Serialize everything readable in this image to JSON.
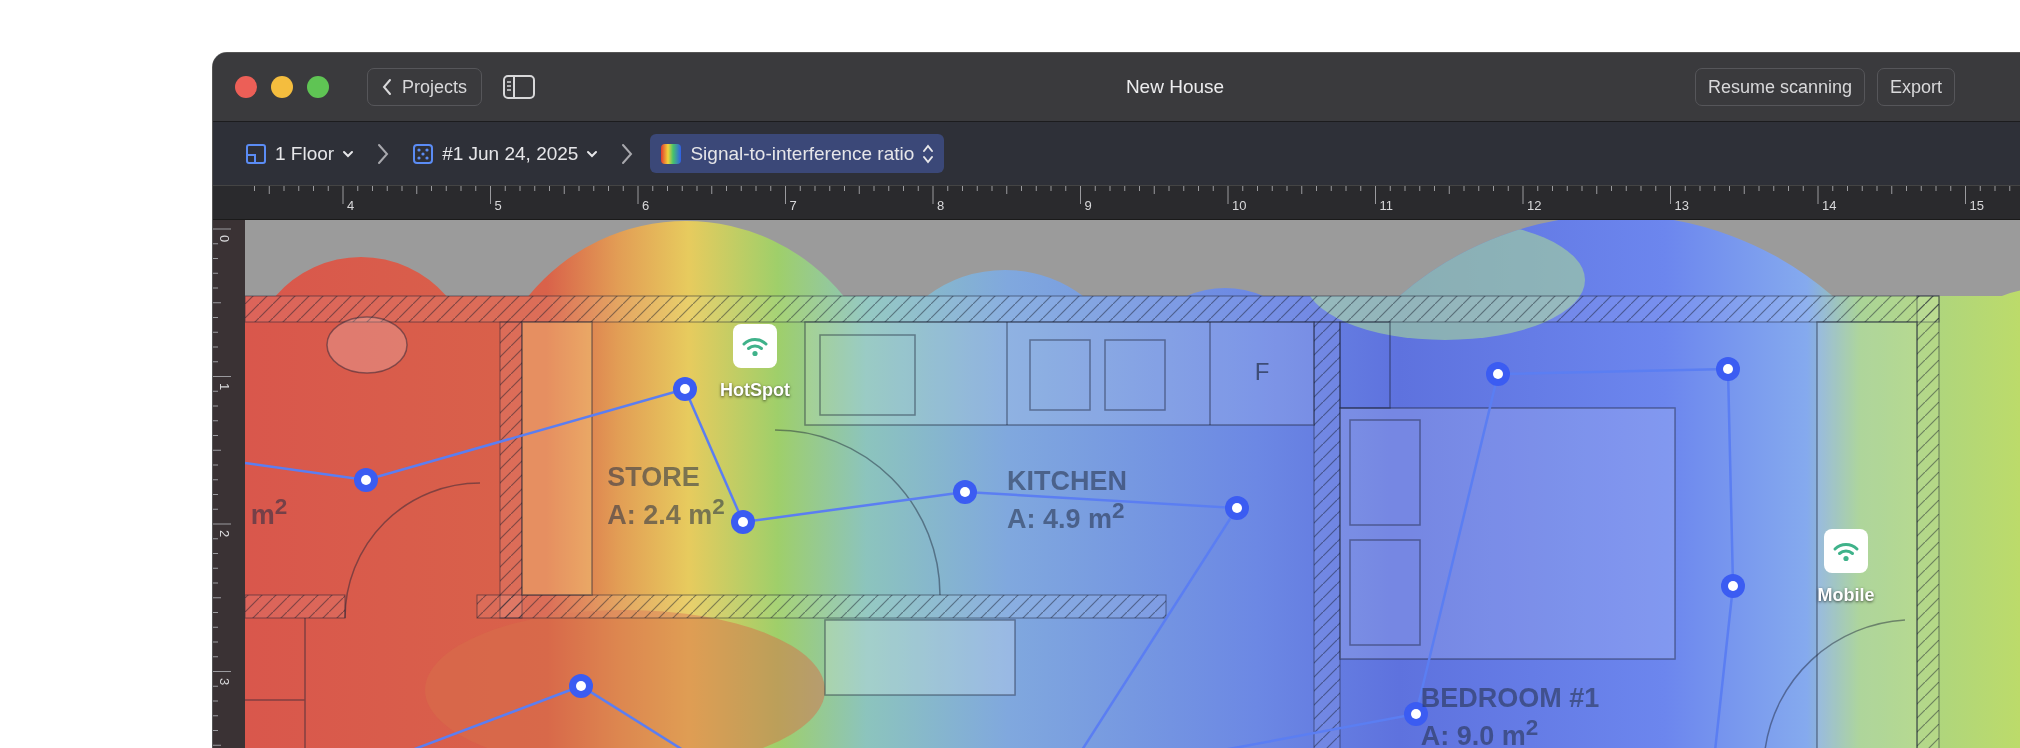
{
  "window": {
    "title": "New House"
  },
  "toolbar": {
    "back_button": "Projects",
    "buttons": [
      "Resume scanning",
      "Export"
    ]
  },
  "breadcrumbs": [
    {
      "kind": "floor",
      "label": "1 Floor",
      "selected": false
    },
    {
      "kind": "scan",
      "label": "#1 Jun 24, 2025",
      "selected": false
    },
    {
      "kind": "visualization",
      "label": "Signal-to-interference ratio",
      "selected": true
    }
  ],
  "ruler": {
    "x_labels": [
      "4",
      "5",
      "6",
      "7",
      "8",
      "9",
      "10",
      "11",
      "12",
      "13",
      "14",
      "15"
    ],
    "y_labels": [
      "0",
      "1",
      "2",
      "3"
    ]
  },
  "map": {
    "rooms": [
      {
        "name": "STORE",
        "area": "A: 2.4 m$^{2}$"
      },
      {
        "name": "KITCHEN",
        "area": "A: 4.9 m$^{2}$"
      },
      {
        "name": "BEDROOM #1",
        "area": "A: 9.0 m$^{2}$"
      }
    ],
    "partial_label": "m$^{2}$",
    "fixture_label": "F",
    "access_points": [
      {
        "name": "HotSpot"
      },
      {
        "name": "Mobile"
      }
    ]
  }
}
